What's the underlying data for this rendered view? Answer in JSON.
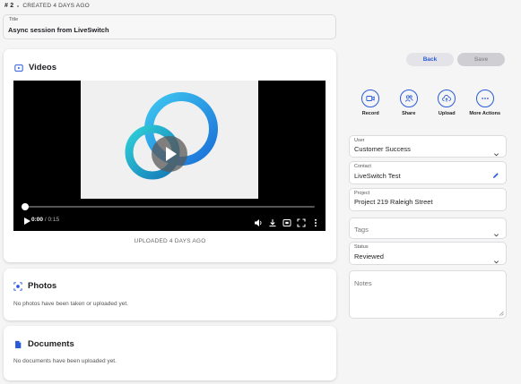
{
  "header": {
    "number": "# 2",
    "created": "CREATED 4 DAYS AGO"
  },
  "title_field": {
    "label": "Title",
    "value": "Async session from LiveSwitch"
  },
  "videos": {
    "heading": "Videos",
    "player": {
      "current_time": "0:00",
      "duration": "/ 0:15",
      "progress": 0
    },
    "uploaded": "UPLOADED 4 DAYS AGO"
  },
  "photos": {
    "heading": "Photos",
    "empty": "No photos have been taken or uploaded yet."
  },
  "documents": {
    "heading": "Documents",
    "empty": "No documents have been uploaded yet."
  },
  "buttons": {
    "back": "Back",
    "save": "Save"
  },
  "actions": [
    {
      "label": "Record",
      "icon": "video-record-icon"
    },
    {
      "label": "Share",
      "icon": "share-users-icon"
    },
    {
      "label": "Upload",
      "icon": "cloud-upload-icon"
    },
    {
      "label": "More Actions",
      "icon": "more-dots-icon"
    }
  ],
  "fields": {
    "user": {
      "label": "User",
      "value": "Customer Success"
    },
    "contact": {
      "label": "Contact",
      "value": "LiveSwitch Test"
    },
    "project": {
      "label": "Project",
      "value": "Project 219 Raleigh Street"
    },
    "tags": {
      "placeholder": "Tags"
    },
    "status": {
      "label": "Status",
      "value": "Reviewed"
    },
    "notes": {
      "placeholder": "Notes"
    }
  },
  "colors": {
    "accent": "#2a5bd7",
    "background": "#f5f5f6",
    "card": "#ffffff"
  }
}
